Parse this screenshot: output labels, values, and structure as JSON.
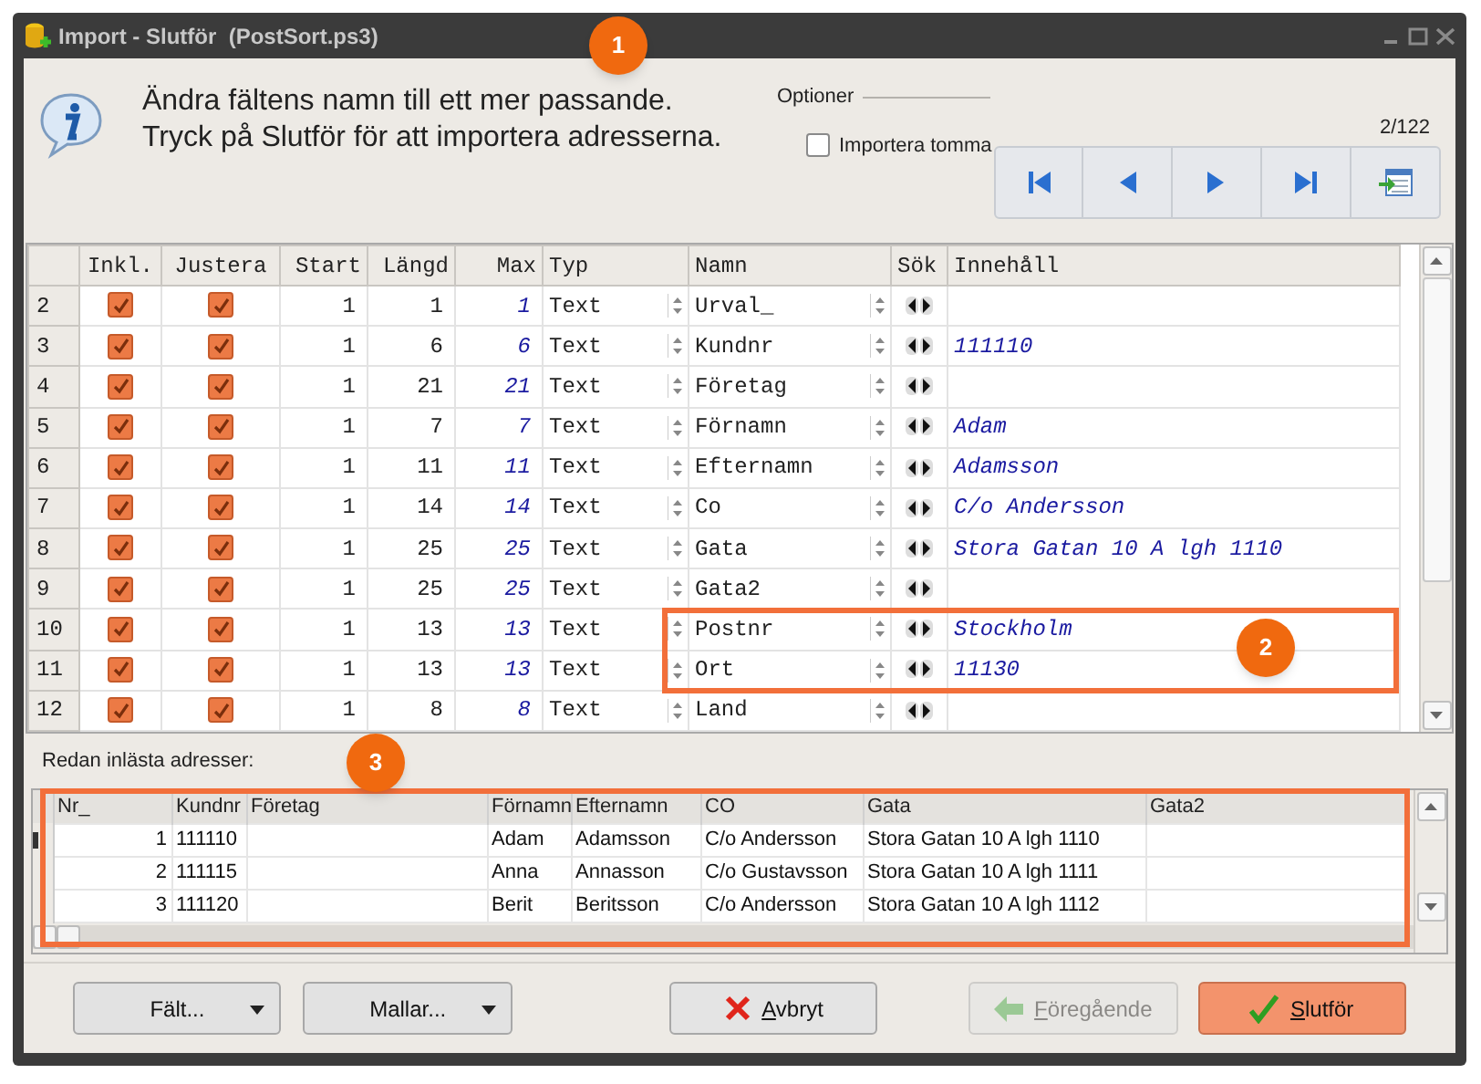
{
  "window": {
    "title": "Import - Slutför  (PostSort.ps3)"
  },
  "message": [
    "Ändra fältens namn till ett mer passande.",
    "Tryck på Slutför för att importera adresserna."
  ],
  "options": {
    "title": "Optioner",
    "checkbox": {
      "label": "Importera tomma",
      "checked": false
    }
  },
  "counter": "2/122",
  "fields": {
    "columns": [
      "Inkl.",
      "Justera",
      "Start",
      "Längd",
      "Max",
      "Typ",
      "Namn",
      "Sök",
      "Innehåll"
    ],
    "rows": [
      {
        "nr": "2",
        "inkl": true,
        "justera": true,
        "start": "1",
        "length": "1",
        "max": "1",
        "type": "Text",
        "name": "Urval_",
        "content": ""
      },
      {
        "nr": "3",
        "inkl": true,
        "justera": true,
        "start": "1",
        "length": "6",
        "max": "6",
        "type": "Text",
        "name": "Kundnr",
        "content": "111110"
      },
      {
        "nr": "4",
        "inkl": true,
        "justera": true,
        "start": "1",
        "length": "21",
        "max": "21",
        "type": "Text",
        "name": "Företag",
        "content": ""
      },
      {
        "nr": "5",
        "inkl": true,
        "justera": true,
        "start": "1",
        "length": "7",
        "max": "7",
        "type": "Text",
        "name": "Förnamn",
        "content": "Adam"
      },
      {
        "nr": "6",
        "inkl": true,
        "justera": true,
        "start": "1",
        "length": "11",
        "max": "11",
        "type": "Text",
        "name": "Efternamn",
        "content": "Adamsson"
      },
      {
        "nr": "7",
        "inkl": true,
        "justera": true,
        "start": "1",
        "length": "14",
        "max": "14",
        "type": "Text",
        "name": "Co",
        "content": "C/o Andersson"
      },
      {
        "nr": "8",
        "inkl": true,
        "justera": true,
        "start": "1",
        "length": "25",
        "max": "25",
        "type": "Text",
        "name": "Gata",
        "content": "Stora Gatan 10 A lgh 1110"
      },
      {
        "nr": "9",
        "inkl": true,
        "justera": true,
        "start": "1",
        "length": "25",
        "max": "25",
        "type": "Text",
        "name": "Gata2",
        "content": ""
      },
      {
        "nr": "10",
        "inkl": true,
        "justera": true,
        "start": "1",
        "length": "13",
        "max": "13",
        "type": "Text",
        "name": "Postnr",
        "content": "Stockholm"
      },
      {
        "nr": "11",
        "inkl": true,
        "justera": true,
        "start": "1",
        "length": "13",
        "max": "13",
        "type": "Text",
        "name": "Ort",
        "content": "11130"
      },
      {
        "nr": "12",
        "inkl": true,
        "justera": true,
        "start": "1",
        "length": "8",
        "max": "8",
        "type": "Text",
        "name": "Land",
        "content": ""
      }
    ]
  },
  "loaded": {
    "label": "Redan inlästa adresser:",
    "columns": [
      "Nr_",
      "Kundnr",
      "Företag",
      "Förnamn",
      "Efternamn",
      "CO",
      "Gata",
      "Gata2"
    ],
    "rows": [
      [
        "1",
        "111110",
        "",
        "Adam",
        "Adamsson",
        "C/o Andersson",
        "Stora Gatan 10 A lgh 1110",
        ""
      ],
      [
        "2",
        "111115",
        "",
        "Anna",
        "Annasson",
        "C/o Gustavsson",
        "Stora Gatan 10 A lgh 1111",
        ""
      ],
      [
        "3",
        "111120",
        "",
        "Berit",
        "Beritsson",
        "C/o Andersson",
        "Stora Gatan 10 A lgh 1112",
        ""
      ]
    ]
  },
  "buttons": [
    {
      "label": "Fält...",
      "kind": "dropdown",
      "disabled": false
    },
    {
      "label": "Mallar...",
      "kind": "dropdown",
      "disabled": false
    },
    {
      "label": "Avbryt",
      "kind": "cancel",
      "disabled": false
    },
    {
      "label": "Föregående",
      "kind": "back",
      "disabled": true
    },
    {
      "label": "Slutför",
      "kind": "finish",
      "disabled": false
    }
  ],
  "callouts": [
    "1",
    "2",
    "3"
  ]
}
